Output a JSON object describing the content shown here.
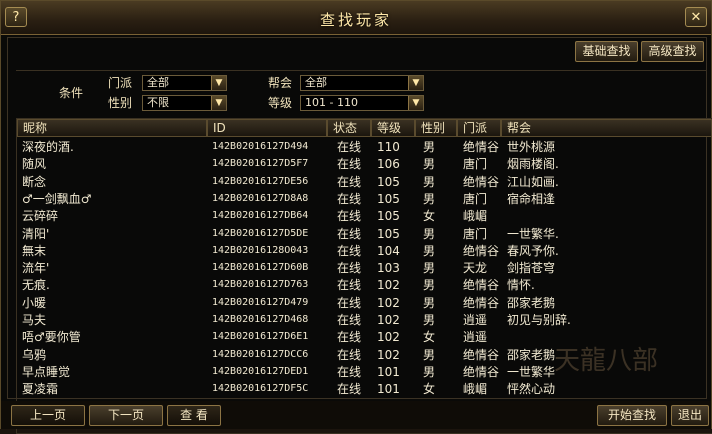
{
  "window": {
    "title": "查找玩家",
    "help_glyph": "?",
    "close_glyph": "✕"
  },
  "top_buttons": {
    "basic": "基础查找",
    "advanced": "高级查找"
  },
  "conditions": {
    "label": "条件",
    "sect_label": "门派",
    "sect_value": "全部",
    "gender_label": "性别",
    "gender_value": "不限",
    "guild_label": "帮会",
    "guild_value": "全部",
    "level_label": "等级",
    "level_value": "101 - 110"
  },
  "columns": [
    "昵称",
    "ID",
    "状态",
    "等级",
    "性别",
    "门派",
    "帮会"
  ],
  "rows": [
    [
      "深夜的酒.",
      "142B02016127D494",
      "在线",
      "110",
      "男",
      "绝情谷",
      "世外桃源"
    ],
    [
      "随风",
      "142B02016127D5F7",
      "在线",
      "106",
      "男",
      "唐门",
      "烟雨楼阁."
    ],
    [
      "断念",
      "142B02016127DE56",
      "在线",
      "105",
      "男",
      "绝情谷",
      "江山如画."
    ],
    [
      "♂一剑飘血♂",
      "142B02016127D8A8",
      "在线",
      "105",
      "男",
      "唐门",
      "宿命相逢"
    ],
    [
      "云碎碎",
      "142B02016127DB64",
      "在线",
      "105",
      "女",
      "峨嵋",
      ""
    ],
    [
      "清阳'",
      "142B02016127D5DE",
      "在线",
      "105",
      "男",
      "唐门",
      "一世繁华."
    ],
    [
      "無末",
      "142B02016128O043",
      "在线",
      "104",
      "男",
      "绝情谷",
      "春风予你."
    ],
    [
      "流年'",
      "142B02016127D60B",
      "在线",
      "103",
      "男",
      "天龙",
      "剑指苍穹"
    ],
    [
      "无痕.",
      "142B02016127D763",
      "在线",
      "102",
      "男",
      "绝情谷",
      "情怀."
    ],
    [
      "小暖",
      "142B02016127D479",
      "在线",
      "102",
      "男",
      "绝情谷",
      "邵家老鹅"
    ],
    [
      "马夫",
      "142B02016127D468",
      "在线",
      "102",
      "男",
      "逍遥",
      "初见与别辞."
    ],
    [
      "唔♂要你管",
      "142B02016127D6E1",
      "在线",
      "102",
      "女",
      "逍遥",
      ""
    ],
    [
      "乌鸦",
      "142B02016127DCC6",
      "在线",
      "102",
      "男",
      "绝情谷",
      "邵家老鹅"
    ],
    [
      "早点睡觉",
      "142B02016127DED1",
      "在线",
      "101",
      "男",
      "绝情谷",
      "一世繁华"
    ],
    [
      "夏凌霜",
      "142B02016127DF5C",
      "在线",
      "101",
      "女",
      "峨嵋",
      "怦然心动"
    ]
  ],
  "bottom_buttons": {
    "prev": "上一页",
    "next": "下一页",
    "view": "查 看",
    "start": "开始查找",
    "exit": "退出"
  },
  "watermark": "天龍八部",
  "colors": {
    "accent": "#ffe8a8",
    "border": "#8c7444",
    "background": "#0a0a08"
  },
  "icons": {
    "help": "help-icon",
    "close": "close-icon",
    "dropdown": "chevron-down-icon"
  }
}
